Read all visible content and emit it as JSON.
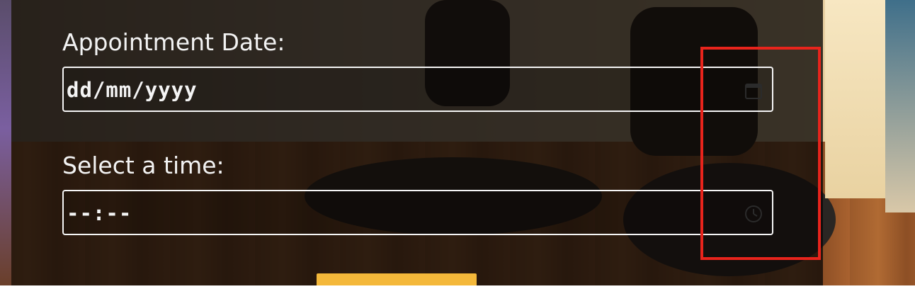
{
  "form": {
    "date_label": "Appointment Date:",
    "date_placeholder": "dd/mm/yyyy",
    "date_icon": "calendar-icon",
    "time_label": "Select a time:",
    "time_placeholder": "--:--",
    "time_icon": "clock-icon",
    "submit_label": ""
  },
  "colors": {
    "overlay": "#0e0a08",
    "input_border": "#f5f5f5",
    "label_text": "#f2f2f2",
    "submit_button": "#f4b83a",
    "highlight_box": "#e8241c"
  }
}
